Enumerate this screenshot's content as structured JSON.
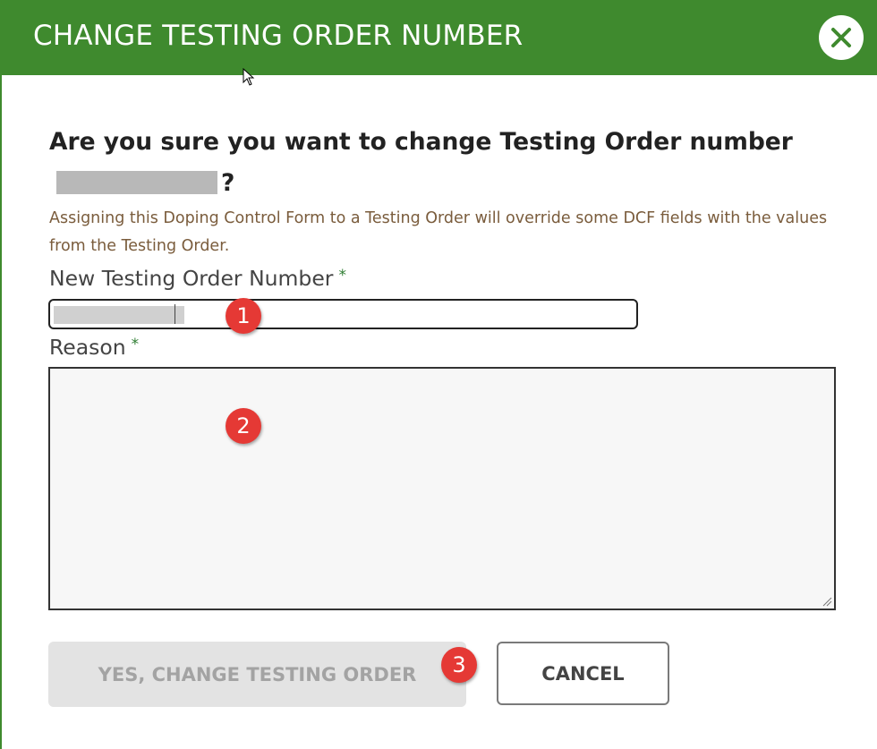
{
  "dialog": {
    "title": "CHANGE TESTING ORDER NUMBER",
    "question_prefix": "Are you sure you want to change Testing Order number",
    "question_suffix": "?",
    "info": "Assigning this Doping Control Form to a Testing Order will override some DCF fields with the values from the Testing Order."
  },
  "form": {
    "new_number_label": "New Testing Order Number",
    "reason_label": "Reason",
    "required_mark": "*",
    "reason_value": ""
  },
  "buttons": {
    "confirm_label": "YES, CHANGE TESTING ORDER",
    "cancel_label": "CANCEL"
  },
  "markers": {
    "m1": "1",
    "m2": "2",
    "m3": "3"
  },
  "icons": {
    "close": "close-icon",
    "cursor": "mouse-pointer-icon",
    "resize": "resize-grip-icon"
  },
  "colors": {
    "header": "#3f8a2e",
    "info_text": "#7a5c3c",
    "required": "#2e7d32",
    "marker": "#e53935"
  }
}
